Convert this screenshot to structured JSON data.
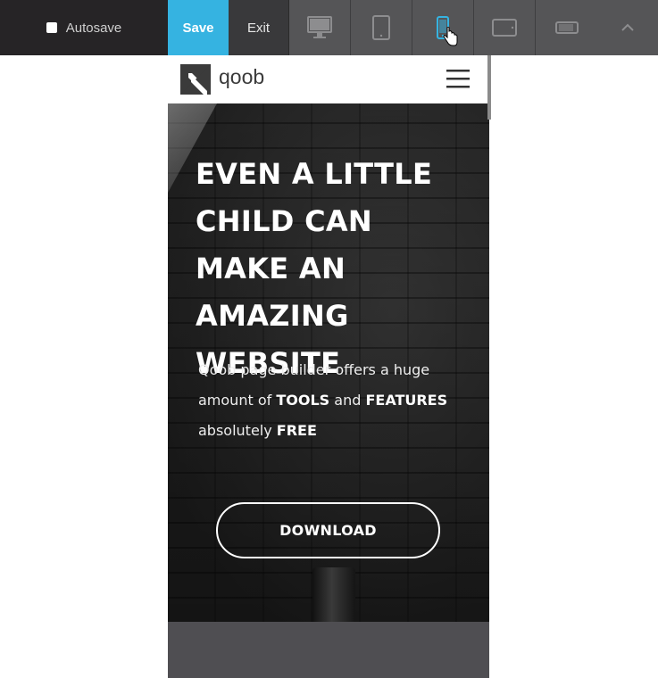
{
  "toolbar": {
    "autosave_label": "Autosave",
    "save_label": "Save",
    "exit_label": "Exit",
    "devices": [
      {
        "icon": "desktop-icon",
        "active": false
      },
      {
        "icon": "tablet-portrait-icon",
        "active": false
      },
      {
        "icon": "phone-portrait-icon",
        "active": true
      },
      {
        "icon": "tablet-landscape-icon",
        "active": false
      },
      {
        "icon": "phone-landscape-icon",
        "active": false
      }
    ],
    "collapse_icon": "chevron-up-icon",
    "colors": {
      "save": "#35b3e1",
      "active_device": "#35b3e1",
      "bar": "#2b2b2d"
    }
  },
  "site": {
    "logo_text": "qoob",
    "menu_icon": "hamburger-icon"
  },
  "hero": {
    "title": "EVEN A LITTLE CHILD CAN MAKE AN AMAZING WEBSITE",
    "text_1": "Qoob page builder offers a huge amount of ",
    "text_2": "TOOLS",
    "text_3": " and ",
    "text_4": "FEATURES",
    "text_5": " absolutely ",
    "text_6": "FREE",
    "button_label": "DOWNLOAD"
  }
}
